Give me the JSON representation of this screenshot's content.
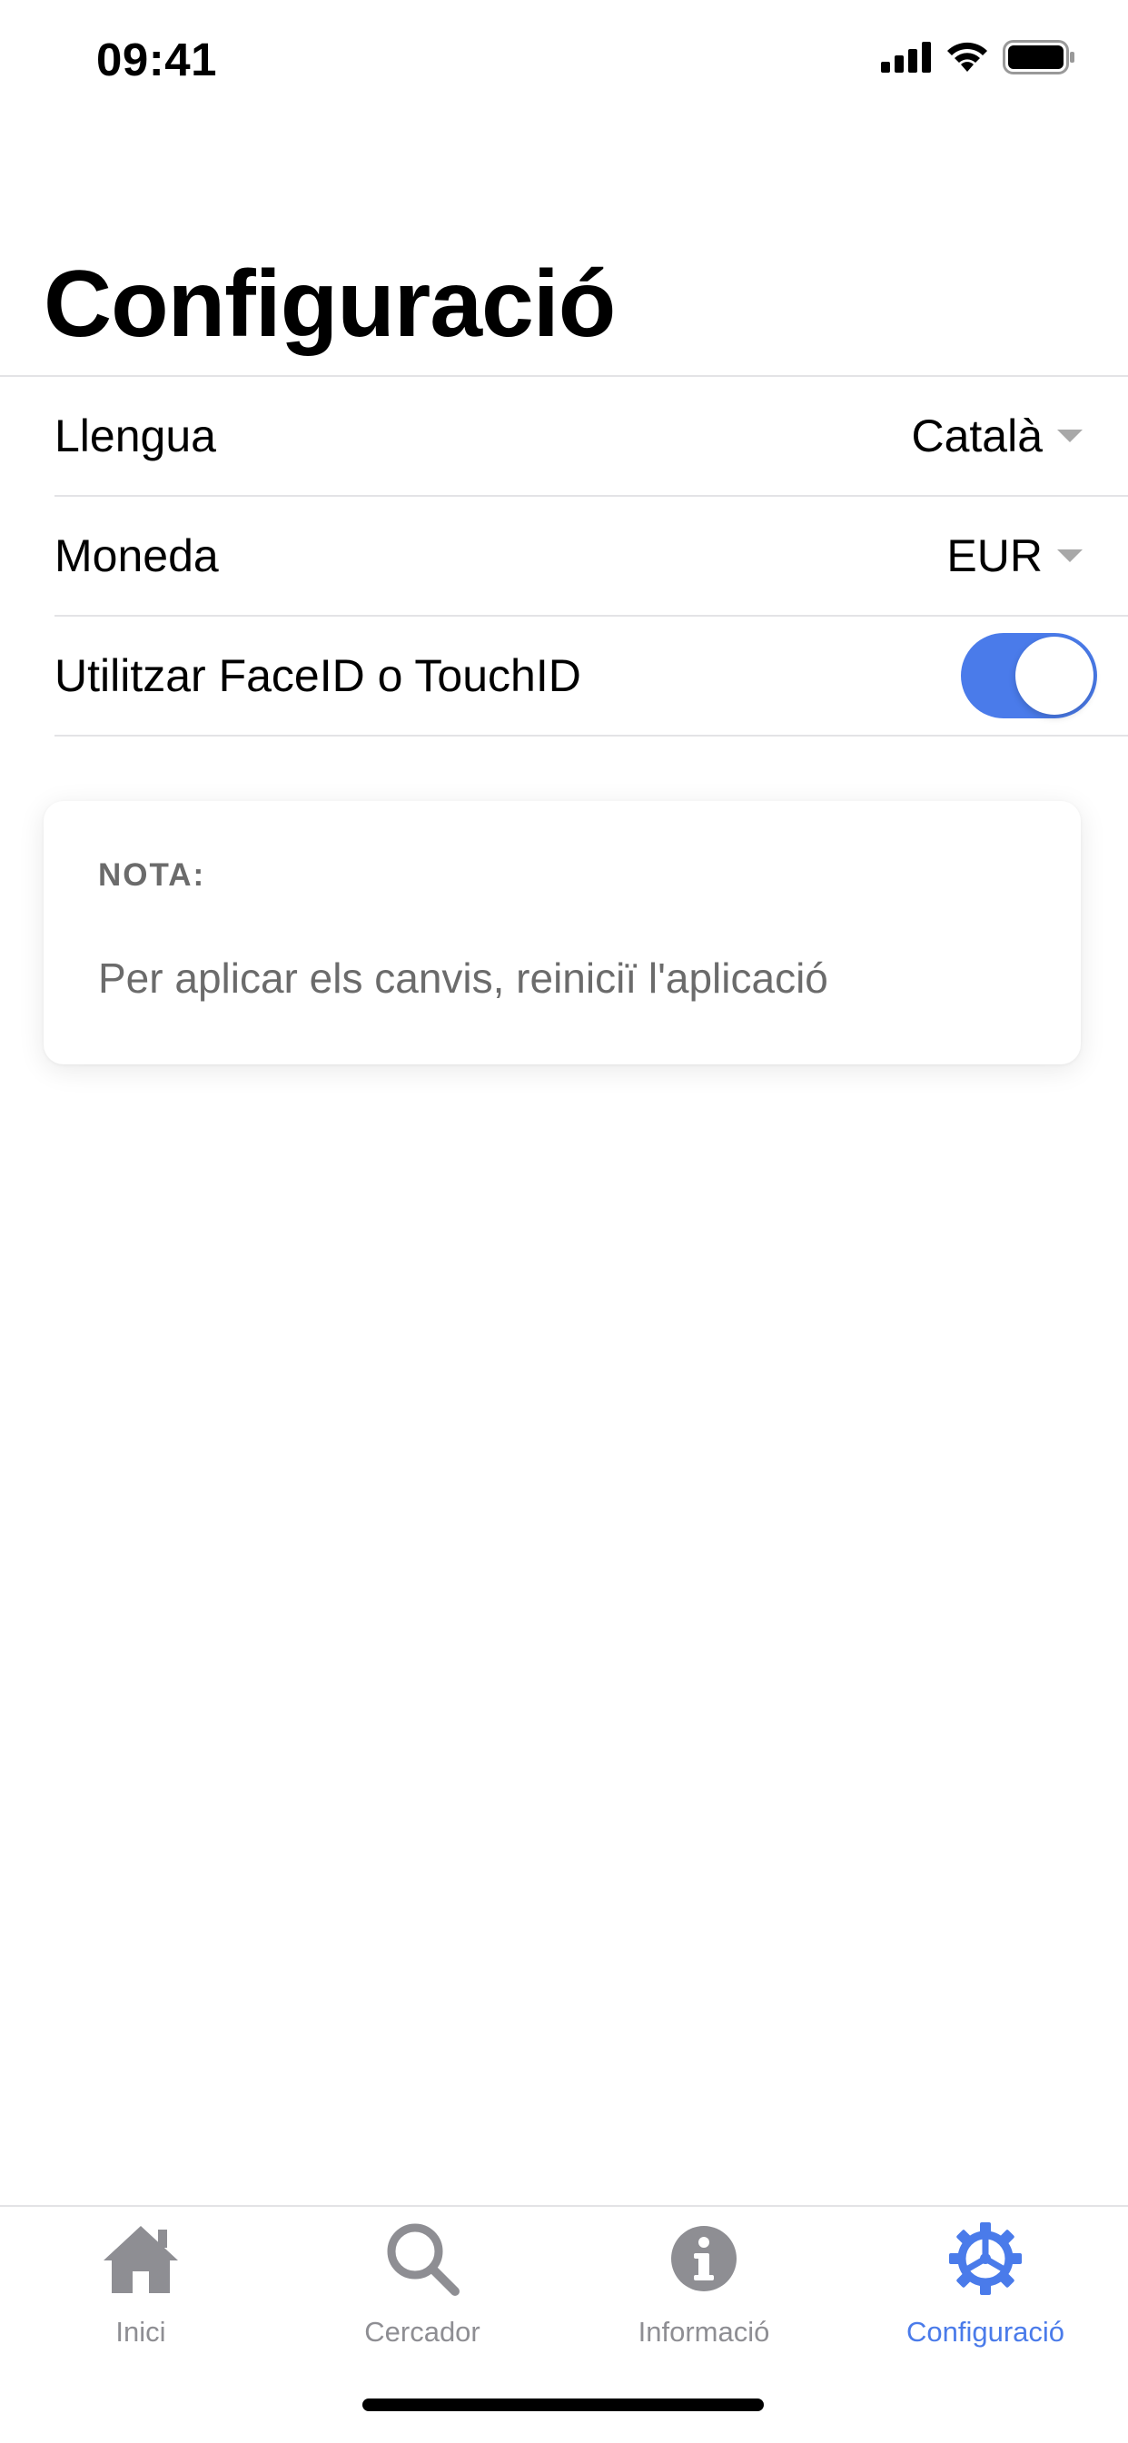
{
  "status_bar": {
    "time": "09:41"
  },
  "page": {
    "title": "Configuració"
  },
  "settings": {
    "language": {
      "label": "Llengua",
      "value": "Català"
    },
    "currency": {
      "label": "Moneda",
      "value": "EUR"
    },
    "biometrics": {
      "label": "Utilitzar FaceID o TouchID",
      "enabled": true
    }
  },
  "note": {
    "title": "NOTA:",
    "text": "Per aplicar els canvis, reiniciï l'aplicació"
  },
  "tab_bar": {
    "items": [
      {
        "label": "Inici",
        "icon": "home-icon",
        "active": false
      },
      {
        "label": "Cercador",
        "icon": "search-icon",
        "active": false
      },
      {
        "label": "Informació",
        "icon": "info-icon",
        "active": false
      },
      {
        "label": "Configuració",
        "icon": "gear-icon",
        "active": true
      }
    ]
  },
  "colors": {
    "accent": "#4a7bea",
    "inactive": "#8e8e93",
    "divider": "#e3e3e6"
  }
}
